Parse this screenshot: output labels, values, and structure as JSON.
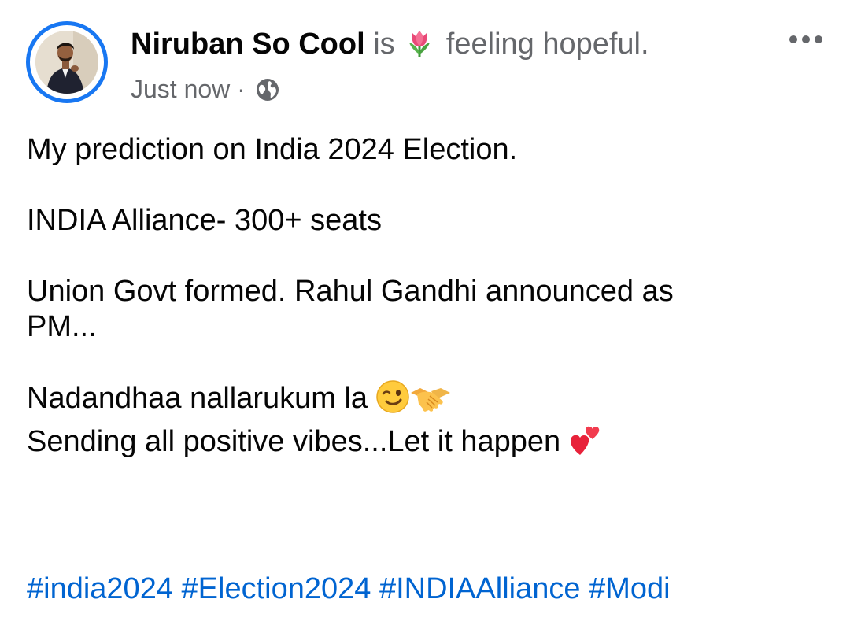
{
  "post": {
    "author": "Niruban So Cool",
    "verb": "is",
    "feeling": "feeling hopeful.",
    "timestamp": "Just now",
    "separator": "·",
    "audience_icon": "globe-icon",
    "feeling_icon": "tulip-icon",
    "more_icon": "more-options-icon"
  },
  "body": {
    "line1": "My prediction on India 2024 Election.",
    "line2": "INDIA Alliance- 300+ seats",
    "line3a": "Union Govt formed. Rahul Gandhi announced as",
    "line3b": "PM...",
    "line4": "Nadandhaa nallarukum la",
    "line5": "Sending all positive vibes...Let it happen"
  },
  "emojis": {
    "wink": "winking-face-icon",
    "handshake": "handshake-icon",
    "hearts": "two-hearts-icon"
  },
  "hashtags": [
    "#india2024",
    "#Election2024",
    "#INDIAAlliance",
    "#Modi"
  ],
  "colors": {
    "accent": "#1877f2",
    "hashtag": "#0064d1",
    "secondary_text": "#65676b",
    "primary_text": "#050505"
  }
}
